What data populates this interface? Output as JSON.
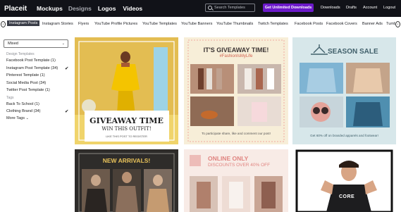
{
  "topbar": {
    "logo": "Placeit",
    "nav": [
      "Mockups",
      "Designs",
      "Logos",
      "Videos"
    ],
    "search_placeholder": "Search Templates",
    "cta": "Get Unlimited Downloads",
    "right": [
      "Downloads",
      "Drafts",
      "Account",
      "Logout"
    ]
  },
  "categories": {
    "prev_icon": "chevron-left-icon",
    "next_icon": "chevron-right-icon",
    "items": [
      "Instagram Posts",
      "Instagram Stories",
      "Flyers",
      "YouTube Profile Pictures",
      "YouTube Templates",
      "YouTube Banners",
      "YouTube Thumbnails",
      "Twitch Templates",
      "Facebook Posts",
      "Facebook Covers",
      "Banner Ads",
      "Tumblr"
    ]
  },
  "sidebar": {
    "sort_value": "Mixed",
    "design_templates_title": "Design Templates",
    "design_templates": [
      {
        "label": "Facebook Post Template",
        "count": "(1)",
        "checked": false
      },
      {
        "label": "Instagram Post Template",
        "count": "(34)",
        "checked": true
      },
      {
        "label": "Pinterest Template",
        "count": "(1)",
        "checked": false
      },
      {
        "label": "Social Media Post",
        "count": "(34)",
        "checked": false
      },
      {
        "label": "Twitter Post Template",
        "count": "(1)",
        "checked": false
      }
    ],
    "tags_title": "Tags",
    "tags": [
      {
        "label": "Back To School",
        "count": "(1)",
        "checked": false
      },
      {
        "label": "Clothing Brand",
        "count": "(34)",
        "checked": true
      }
    ],
    "more_tags": "More Tags"
  },
  "cards": {
    "c1": {
      "headline": "GIVEAWAY TIME",
      "sub": "WIN THIS OUTFIT!",
      "foot": "LIKE THIS POST TO REGISTER"
    },
    "c2": {
      "headline": "IT'S GIVEAWAY TIME!",
      "hashtag": "#FashionIsMyLife",
      "foot": "To participate share, like and comment our post!"
    },
    "c3": {
      "headline": "SEASON SALE",
      "foot": "Get 60% off on branded apparels and footwear!"
    },
    "c4": {
      "headline": "NEW ARRIVALS!"
    },
    "c5": {
      "headline": "ONLINE ONLY",
      "sub": "DISCOUNTS OVER 40% OFF"
    },
    "c6": {
      "shirt": "CORE"
    }
  },
  "colors": {
    "accent": "#6b19c9",
    "topbar": "#111218"
  }
}
